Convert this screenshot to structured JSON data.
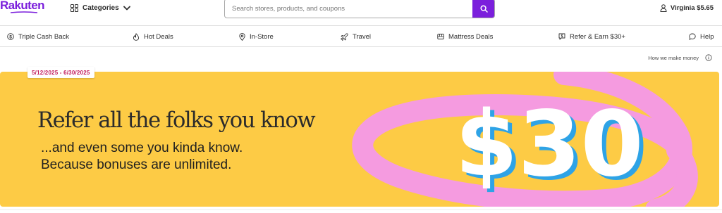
{
  "brand": {
    "name": "Rakuten",
    "color": "#7b1fdc"
  },
  "header": {
    "categories_label": "Categories",
    "search": {
      "placeholder": "Search stores, products, and coupons",
      "value": ""
    },
    "account_label": "Virginia $5.65"
  },
  "nav": {
    "items": [
      {
        "label": "Triple Cash Back",
        "icon": "cashback-icon"
      },
      {
        "label": "Hot Deals",
        "icon": "flame-icon"
      },
      {
        "label": "In-Store",
        "icon": "location-pin-icon"
      },
      {
        "label": "Travel",
        "icon": "plane-icon"
      },
      {
        "label": "Mattress Deals",
        "icon": "bed-icon"
      },
      {
        "label": "Refer & Earn $30+",
        "icon": "gift-chat-icon"
      },
      {
        "label": "Help",
        "icon": "chat-bubble-icon"
      }
    ]
  },
  "disclaimer": {
    "label": "How we make money",
    "icon": "info-icon"
  },
  "banner": {
    "date_range": "5/12/2025 - 6/30/2025",
    "headline": "Refer all the folks you know",
    "subline_1": "...and even some you kinda know.",
    "subline_2": "Because bonuses are unlimited.",
    "amount": "$30",
    "colors": {
      "background": "#fdcb45",
      "ribbon": "#f59be0",
      "amount_shadow": "#2ea3e6",
      "amount_fill": "#ffffff",
      "date": "#c2185b"
    }
  }
}
